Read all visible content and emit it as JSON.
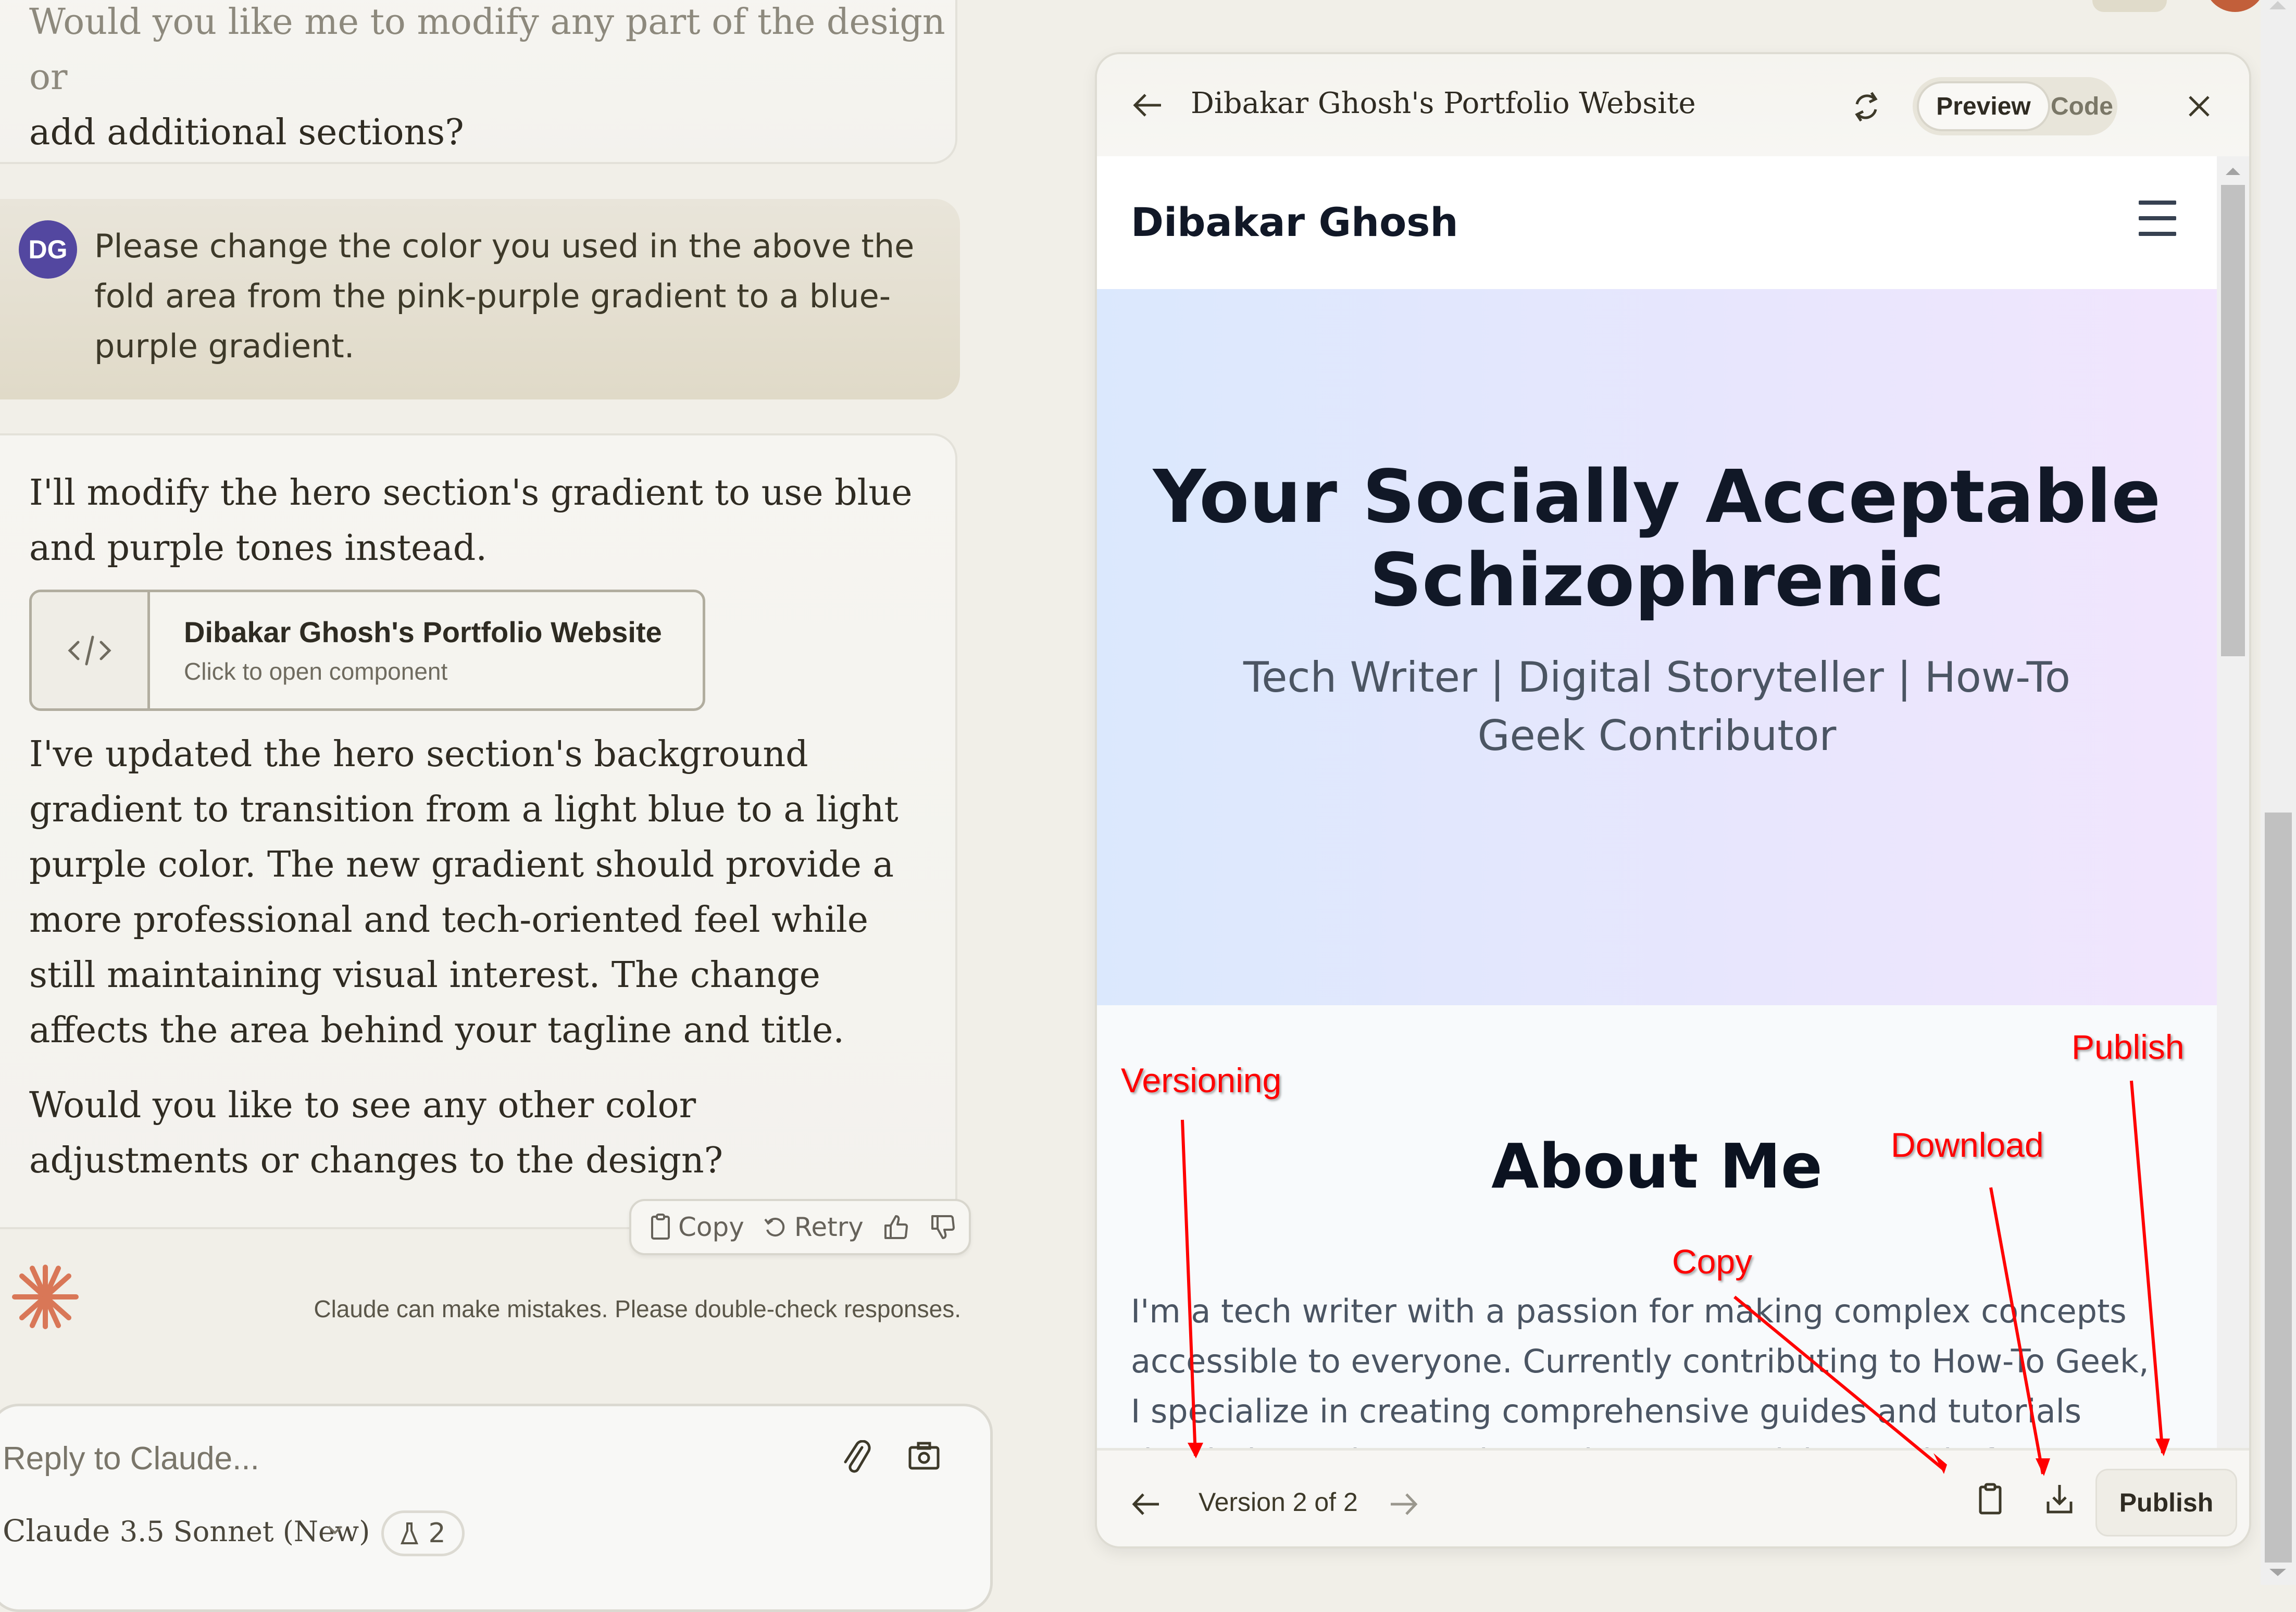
{
  "chat": {
    "previous_assistant_tail": {
      "line1": "Would you like me to modify any part of the design or",
      "line2": "add additional sections?"
    },
    "user_message": {
      "avatar_initials": "DG",
      "avatar_color": "#5347a0",
      "text": "Please change the  color you used in the above the fold area from the pink-purple gradient to a blue-purple gradient."
    },
    "assistant_message": {
      "intro": "I'll modify the hero section's gradient to use blue and purple tones instead.",
      "artifact_card": {
        "icon": "code-icon",
        "title": "Dibakar Ghosh's Portfolio Website",
        "subtitle": "Click to open component"
      },
      "body": "I've updated the hero section's background gradient to transition from a light blue to a light purple color. The new gradient should provide a more professional and tech-oriented feel while still maintaining visual interest. The change affects the area behind your tagline and title.",
      "closing": "Would you like to see any other color adjustments or changes to the design?"
    },
    "actions": {
      "copy": "Copy",
      "retry": "Retry",
      "thumbs_up": "thumbs-up-icon",
      "thumbs_down": "thumbs-down-icon"
    },
    "disclaimer": "Claude can make mistakes. Please double-check responses.",
    "brand_color": "#d97757"
  },
  "composer": {
    "placeholder": "Reply to Claude...",
    "model_name": "Claude",
    "model_version": "3.5 Sonnet (New)",
    "tools_count": "2"
  },
  "artifact_panel": {
    "title": "Dibakar Ghosh's Portfolio Website",
    "tabs": [
      {
        "label": "Preview",
        "active": true
      },
      {
        "label": "Code",
        "active": false
      }
    ],
    "preview": {
      "brand": "Dibakar Ghosh",
      "hero_title": "Your Socially Acceptable Schizophrenic",
      "hero_tagline": "Tech Writer | Digital Storyteller | How-To Geek Contributor",
      "hero_gradient": [
        "#dbe8fd",
        "#f1e5fd"
      ],
      "about_heading": "About Me",
      "about_text": "I'm a tech writer with a passion for making complex concepts accessible to everyone. Currently contributing to How-To Geek, I specialize in creating comprehensive guides and tutorials that help readers navigate the ever-evolving world of technology."
    },
    "footer": {
      "version_label": "Version 2 of 2",
      "publish_label": "Publish"
    }
  },
  "annotations": {
    "versioning": "Versioning",
    "publish": "Publish",
    "download": "Download",
    "copy": "Copy",
    "color": "#ff0000"
  }
}
